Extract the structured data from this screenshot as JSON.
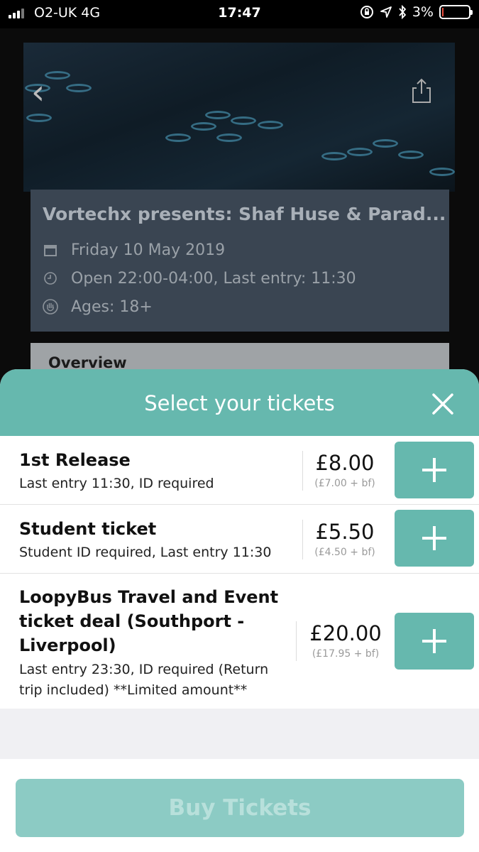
{
  "status_bar": {
    "carrier": "O2-UK   4G",
    "time": "17:47",
    "battery": "3%"
  },
  "event": {
    "title": "Vortechx presents: Shaf Huse & Parad...",
    "date": "Friday 10 May 2019",
    "hours": "Open 22:00-04:00, Last entry: 11:30",
    "ages": "Ages: 18+",
    "overview_tab": "Overview"
  },
  "sheet": {
    "title": "Select your tickets"
  },
  "tickets": [
    {
      "name": "1st Release",
      "desc": "Last entry 11:30, ID required",
      "price": "£8.00",
      "breakdown": "(£7.00 + bf)"
    },
    {
      "name": "Student ticket",
      "desc": "Student ID required, Last entry 11:30",
      "price": "£5.50",
      "breakdown": "(£4.50 + bf)"
    },
    {
      "name_lines": [
        "LoopyBus Travel and Event",
        "ticket deal (Southport -",
        "Liverpool)"
      ],
      "desc_lines": [
        "Last entry 23:30, ID required (Return",
        "trip included) **Limited amount**"
      ],
      "price": "£20.00",
      "breakdown": "(£17.95 + bf)"
    }
  ],
  "footer": {
    "buy_label": "Buy Tickets"
  },
  "colors": {
    "accent": "#66b8ae",
    "buy_disabled": "#8ccbc4"
  }
}
